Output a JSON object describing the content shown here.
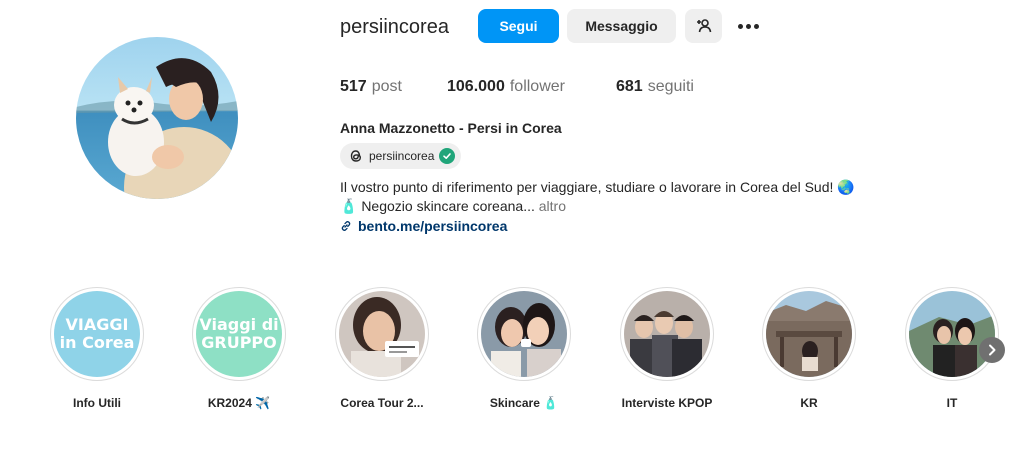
{
  "profile": {
    "username": "persiincorea",
    "follow_label": "Segui",
    "message_label": "Messaggio",
    "full_name": "Anna Mazzonetto - Persi in Corea",
    "threads_handle": "persiincorea",
    "bio_line1": "Il vostro punto di riferimento per viaggiare, studiare o lavorare in Corea del Sud! 🌏",
    "bio_line2": "🧴 Negozio skincare coreana...",
    "bio_more": " altro",
    "link": "bento.me/persiincorea"
  },
  "stats": {
    "posts_value": "517",
    "posts_label": "post",
    "followers_value": "106.000",
    "followers_label": "follower",
    "following_value": "681",
    "following_label": "seguiti"
  },
  "highlights": [
    {
      "label": "Info Utili",
      "cover_text_1": "VIAGGI",
      "cover_text_2": "in Corea",
      "cover_color": "#8fd3e8"
    },
    {
      "label": "KR2024 ✈️",
      "cover_text_1": "Viaggi di",
      "cover_text_2": "GRUPPO",
      "cover_color": "#8ee0c5"
    },
    {
      "label": "Corea Tour 2..."
    },
    {
      "label": "Skincare 🧴"
    },
    {
      "label": "Interviste KPOP"
    },
    {
      "label": "KR"
    },
    {
      "label": "IT"
    }
  ],
  "icons": {
    "add_user": "add-person-icon",
    "more": "more-horizontal-icon",
    "threads": "threads-icon",
    "verified": "verified-check-icon",
    "link": "link-icon",
    "next": "chevron-right-icon"
  },
  "colors": {
    "primary": "#0095f6",
    "secondary_bg": "#efefef",
    "link": "#00376b",
    "verified": "#20a57a"
  }
}
